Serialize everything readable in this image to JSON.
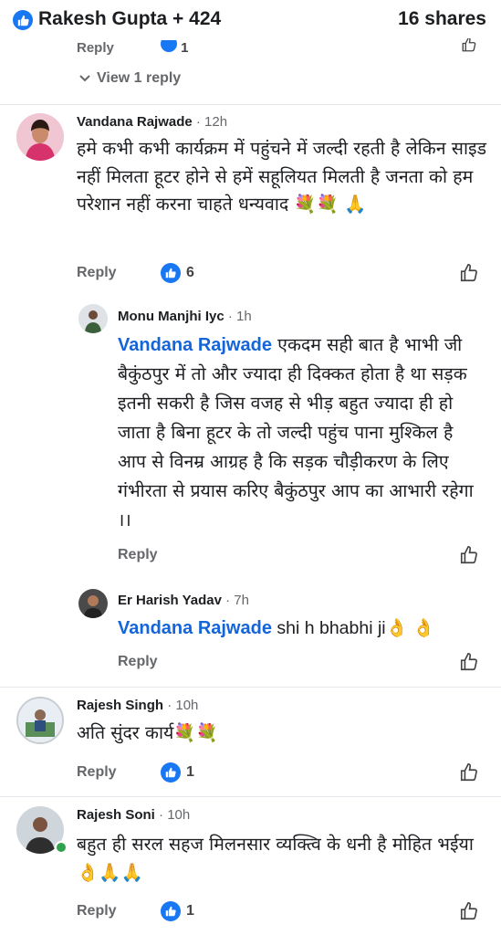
{
  "header": {
    "reactions_label": "Rakesh Gupta + 424",
    "shares_label": "16 shares"
  },
  "top_partial": {
    "reply_label": "Reply",
    "count": "1"
  },
  "view_replies_label": "View 1 reply",
  "comments": [
    {
      "author": "Vandana Rajwade",
      "time": "· 12h",
      "text": "हमे कभी कभी कार्यक्रम में पहुंचने में जल्दी रहती है लेकिन साइड नहीं मिलता हूटर होने से हमें सहूलियत मिलती है जनता को हम परेशान नहीं करना चाहते धन्यवाद 💐💐 🙏",
      "reply_label": "Reply",
      "reactions": "6"
    },
    {
      "author": "Monu Manjhi Iyc",
      "time": "· 1h",
      "mention": "Vandana Rajwade",
      "text": " एकदम सही बात है भाभी जी बैकुंठपुर में तो और ज्यादा ही दिक्कत होता है था सड़क इतनी सकरी है जिस वजह से भीड़ बहुत ज्यादा ही हो जाता है बिना हूटर के तो जल्दी पहुंच पाना मुश्किल है आप से विनम्र आग्रह है कि सड़क चौड़ीकरण के लिए गंभीरता से प्रयास करिए बैकुंठपुर आप का आभारी रहेगा ।।",
      "reply_label": "Reply"
    },
    {
      "author": "Er Harish Yadav",
      "time": "· 7h",
      "mention": "Vandana Rajwade",
      "text": " shi h bhabhi ji👌 👌",
      "reply_label": "Reply"
    },
    {
      "author": "Rajesh Singh",
      "time": "· 10h",
      "text": "अति सुंदर कार्य💐💐",
      "reply_label": "Reply",
      "reactions": "1"
    },
    {
      "author": "Rajesh Soni",
      "time": "· 10h",
      "text": "बहुत ही सरल सहज मिलनसार व्यक्त्वि के धनी है मोहित भईया 👌🙏🙏",
      "reply_label": "Reply",
      "reactions": "1"
    }
  ],
  "colors": {
    "facebook_blue": "#1877f2",
    "mention_blue": "#1565d8",
    "muted_gray": "#65676b",
    "online_green": "#31a24c"
  }
}
